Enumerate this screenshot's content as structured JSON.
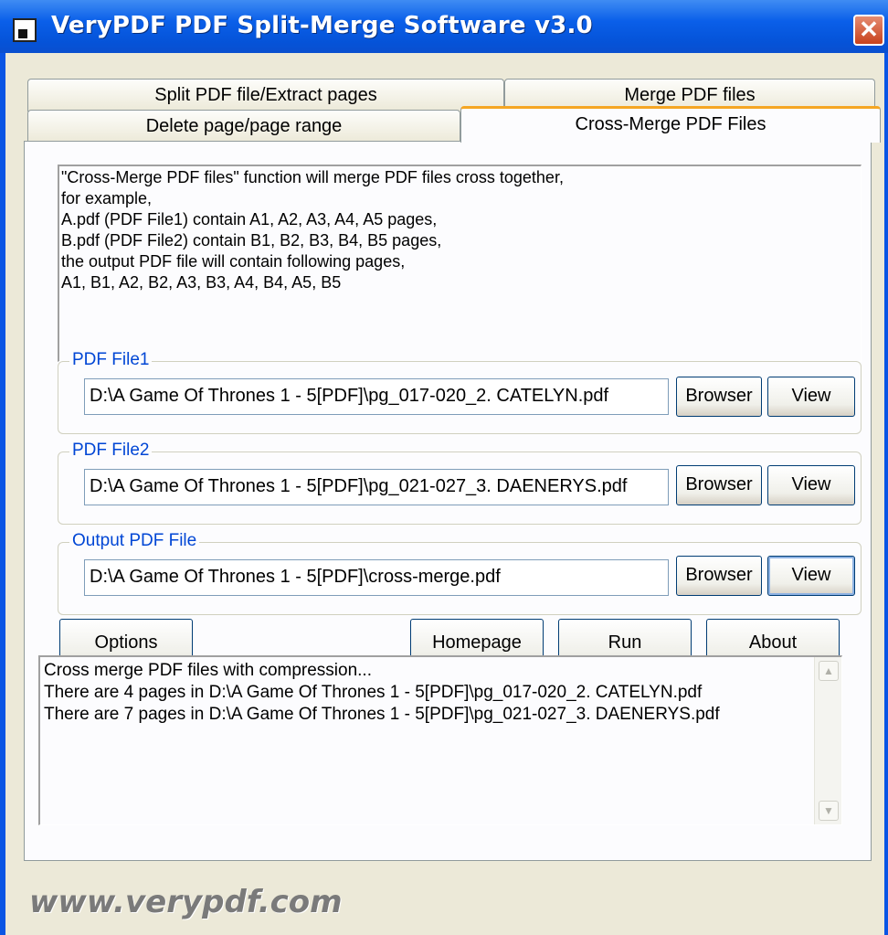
{
  "window": {
    "title": "VeryPDF PDF Split-Merge Software v3.0",
    "close_glyph": "✕"
  },
  "tabs": [
    {
      "label": "Split PDF file/Extract pages"
    },
    {
      "label": "Merge PDF files"
    },
    {
      "label": "Delete page/page range"
    },
    {
      "label": "Cross-Merge PDF Files",
      "active": true
    }
  ],
  "description": [
    "\"Cross-Merge PDF files\" function will merge PDF files cross together,",
    "for example,",
    "A.pdf (PDF File1) contain A1, A2, A3, A4, A5 pages,",
    "B.pdf (PDF File2) contain B1, B2, B3, B4, B5 pages,",
    "the output PDF file will contain following pages,",
    "A1, B1, A2, B2, A3, B3, A4, B4, A5, B5"
  ],
  "file1": {
    "label": "PDF File1",
    "value": "D:\\A Game Of Thrones 1 - 5[PDF]\\pg_017-020_2. CATELYN.pdf"
  },
  "file2": {
    "label": "PDF File2",
    "value": "D:\\A Game Of Thrones 1 - 5[PDF]\\pg_021-027_3. DAENERYS.pdf"
  },
  "output": {
    "label": "Output PDF File",
    "value": "D:\\A Game Of Thrones 1 - 5[PDF]\\cross-merge.pdf"
  },
  "buttons": {
    "browser": "Browser",
    "view": "View",
    "options": "Options",
    "homepage": "Homepage",
    "run": "Run",
    "about": "About"
  },
  "status_log": [
    "Cross merge PDF files with compression...",
    "There are 4 pages in D:\\A Game Of Thrones 1 - 5[PDF]\\pg_017-020_2. CATELYN.pdf",
    "There are 7 pages in D:\\A Game Of Thrones 1 - 5[PDF]\\pg_021-027_3. DAENERYS.pdf"
  ],
  "footer": {
    "url": "www.verypdf.com"
  },
  "colors": {
    "titlebar": "#0a5fe9",
    "group_label": "#0046d5",
    "active_tab_accent": "#f5a623"
  }
}
